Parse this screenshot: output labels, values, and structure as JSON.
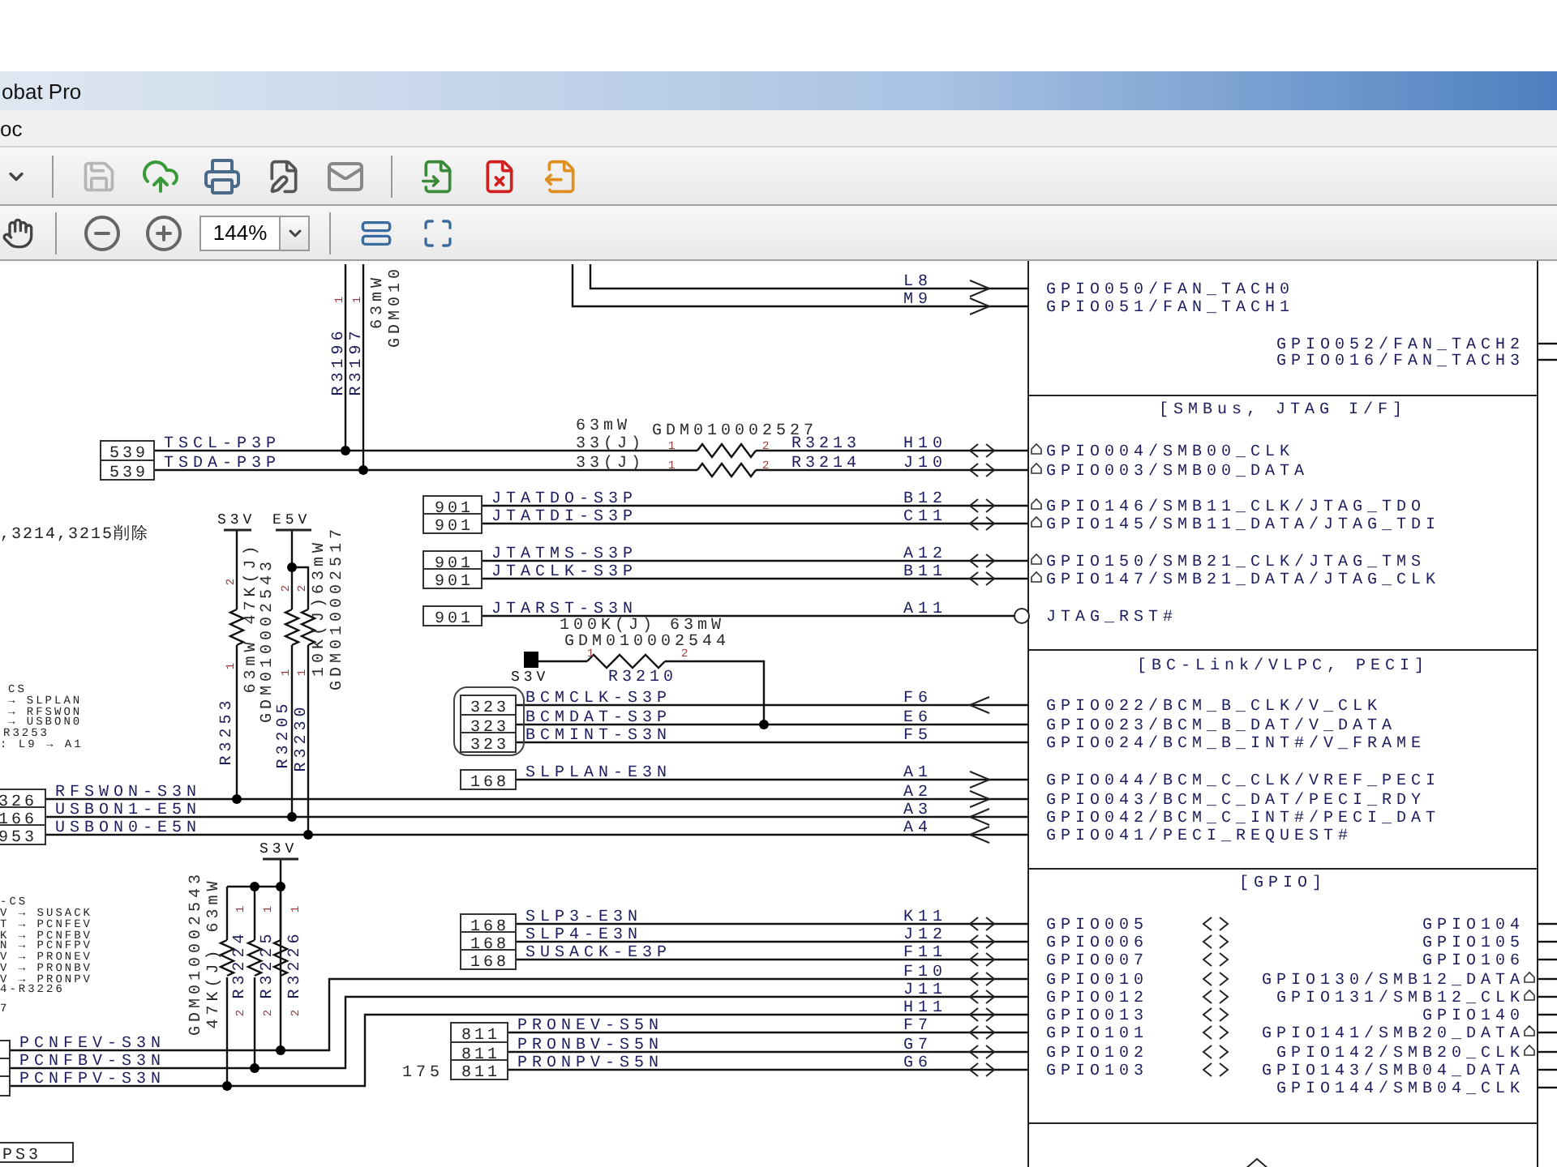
{
  "window": {
    "title": "obat Pro"
  },
  "menu": [
    "oc"
  ],
  "zoom": {
    "value": "144%"
  },
  "schematic": {
    "chip_sections": [
      {
        "left": [
          "GPIO050/FAN_TACH0",
          "GPIO051/FAN_TACH1"
        ],
        "right": [
          "GPIO052/FAN_TACH2",
          "GPIO016/FAN_TACH3"
        ]
      },
      {
        "title": "[SMBus, JTAG I/F]",
        "left": [
          "GPIO004/SMB00_CLK",
          "GPIO003/SMB00_DATA",
          "GPIO146/SMB11_CLK/JTAG_TDO",
          "GPIO145/SMB11_DATA/JTAG_TDI",
          "GPIO150/SMB21_CLK/JTAG_TMS",
          "GPIO147/SMB21_DATA/JTAG_CLK",
          "JTAG_RST#"
        ]
      },
      {
        "title": "[BC-Link/VLPC, PECI]",
        "left": [
          "GPIO022/BCM_B_CLK/V_CLK",
          "GPIO023/BCM_B_DAT/V_DATA",
          "GPIO024/BCM_B_INT#/V_FRAME",
          "GPIO044/BCM_C_CLK/VREF_PECI",
          "GPIO043/BCM_C_DAT/PECI_RDY",
          "GPIO042/BCM_C_INT#/PECI_DAT",
          "GPIO041/PECI_REQUEST#"
        ]
      },
      {
        "title": "[GPIO]",
        "left": [
          "GPIO005",
          "GPIO006",
          "GPIO007",
          "GPIO010",
          "GPIO012",
          "GPIO013",
          "GPIO101",
          "GPIO102",
          "GPIO103"
        ],
        "right": [
          "GPIO104",
          "GPIO105",
          "GPIO106",
          "GPIO130/SMB12_DATA",
          "GPIO131/SMB12_CLK",
          "GPIO140",
          "GPIO141/SMB20_DATA",
          "GPIO142/SMB20_CLK",
          "GPIO143/SMB04_DATA",
          "GPIO144/SMB04_CLK"
        ]
      }
    ],
    "balls": [
      "L8",
      "M9",
      "H10",
      "J10",
      "B12",
      "C11",
      "A12",
      "B11",
      "A11",
      "F6",
      "E6",
      "F5",
      "A1",
      "A2",
      "A3",
      "A4",
      "K11",
      "J12",
      "F11",
      "F10",
      "J11",
      "H11",
      "F7",
      "G7",
      "G6"
    ],
    "connectors": [
      {
        "ref": "539",
        "net": "TSCL-P3P"
      },
      {
        "ref": "539",
        "net": "TSDA-P3P"
      },
      {
        "ref": "901",
        "net": "JTATDO-S3P"
      },
      {
        "ref": "901",
        "net": "JTATDI-S3P"
      },
      {
        "ref": "901",
        "net": "JTATMS-S3P"
      },
      {
        "ref": "901",
        "net": "JTACLK-S3P"
      },
      {
        "ref": "901",
        "net": "JTARST-S3N"
      },
      {
        "ref": "323",
        "net": "BCMCLK-S3P"
      },
      {
        "ref": "323",
        "net": "BCMDAT-S3P"
      },
      {
        "ref": "323",
        "net": "BCMINT-S3N"
      },
      {
        "ref": "168",
        "net": "SLPLAN-E3N"
      },
      {
        "ref": "326",
        "net": "RFSWON-S3N"
      },
      {
        "ref": "166",
        "net": "USBON1-E5N"
      },
      {
        "ref": "953",
        "net": "USBON0-E5N"
      },
      {
        "ref": "168",
        "net": "SLP3-E3N"
      },
      {
        "ref": "168",
        "net": "SLP4-E3N"
      },
      {
        "ref": "168",
        "net": "SUSACK-E3P"
      },
      {
        "ref": "811",
        "net": "PRONEV-S5N"
      },
      {
        "ref": "811",
        "net": "PRONBV-S5N"
      },
      {
        "ref": "811",
        "net": "PRONPV-S5N"
      },
      {
        "net": "PCNFEV-S3N"
      },
      {
        "net": "PCNFBV-S3N"
      },
      {
        "net": "PCNFPV-S3N"
      },
      {
        "ref": "PS3"
      }
    ],
    "labels": [
      {
        "kind": "ref",
        "text": "R3196"
      },
      {
        "kind": "ref",
        "text": "R3197"
      },
      {
        "kind": "pin",
        "text": "1"
      },
      {
        "kind": "pin",
        "text": "1"
      },
      {
        "kind": "value",
        "text": "63mW"
      },
      {
        "kind": "value",
        "text": "GDM010"
      },
      {
        "kind": "value",
        "text": "63mW"
      },
      {
        "kind": "value",
        "text": "GDM010002527"
      },
      {
        "kind": "value",
        "text": "33(J)"
      },
      {
        "kind": "value",
        "text": "33(J)"
      },
      {
        "kind": "pin",
        "text": "1"
      },
      {
        "kind": "pin",
        "text": "2"
      },
      {
        "kind": "pin",
        "text": "1"
      },
      {
        "kind": "pin",
        "text": "2"
      },
      {
        "kind": "ref",
        "text": "R3213"
      },
      {
        "kind": "ref",
        "text": "R3214"
      },
      {
        "kind": "value",
        "text": "100K(J)  63mW"
      },
      {
        "kind": "value",
        "text": "GDM010002544"
      },
      {
        "kind": "pin",
        "text": "1"
      },
      {
        "kind": "pin",
        "text": "2"
      },
      {
        "kind": "ref",
        "text": "R3210"
      },
      {
        "kind": "power",
        "text": "S3V"
      },
      {
        "kind": "power",
        "text": "S3V"
      },
      {
        "kind": "power",
        "text": "E5V"
      },
      {
        "kind": "pin",
        "text": "2"
      },
      {
        "kind": "pin",
        "text": "1"
      },
      {
        "kind": "ref",
        "text": "R3253"
      },
      {
        "kind": "value",
        "text": "63mW 47K(J)"
      },
      {
        "kind": "value",
        "text": "GDM010002543"
      },
      {
        "kind": "pin",
        "text": "2"
      },
      {
        "kind": "pin",
        "text": "2"
      },
      {
        "kind": "pin",
        "text": "1"
      },
      {
        "kind": "pin",
        "text": "1"
      },
      {
        "kind": "ref",
        "text": "R3205"
      },
      {
        "kind": "ref",
        "text": "R3230"
      },
      {
        "kind": "value",
        "text": "10K(J)63mW"
      },
      {
        "kind": "value",
        "text": "GDM010002517"
      },
      {
        "kind": "power",
        "text": "S3V"
      },
      {
        "kind": "value",
        "text": "GDM010002543"
      },
      {
        "kind": "value",
        "text": "47K(J) 63mW"
      },
      {
        "kind": "pin",
        "text": "1"
      },
      {
        "kind": "pin",
        "text": "1"
      },
      {
        "kind": "pin",
        "text": "1"
      },
      {
        "kind": "ref",
        "text": "R3224"
      },
      {
        "kind": "ref",
        "text": "R3225"
      },
      {
        "kind": "ref",
        "text": "R3226"
      },
      {
        "kind": "pin",
        "text": "2"
      },
      {
        "kind": "pin",
        "text": "2"
      },
      {
        "kind": "pin",
        "text": "2"
      },
      {
        "kind": "value",
        "text": "175"
      }
    ],
    "deleted_note": ",3214,3215削除",
    "notes": [
      "CS",
      "→ SLPLAN",
      "→ RFSWON",
      "→ USBON0",
      "R3253",
      ": L9 → A1",
      "-CS",
      "V → SUSACK",
      "T → PCNFEV",
      "K → PCNFBV",
      "N → PCNFPV",
      "V → PRONEV",
      "V → PRONBV",
      "V → PRONPV",
      "4-R3226",
      "7"
    ]
  }
}
